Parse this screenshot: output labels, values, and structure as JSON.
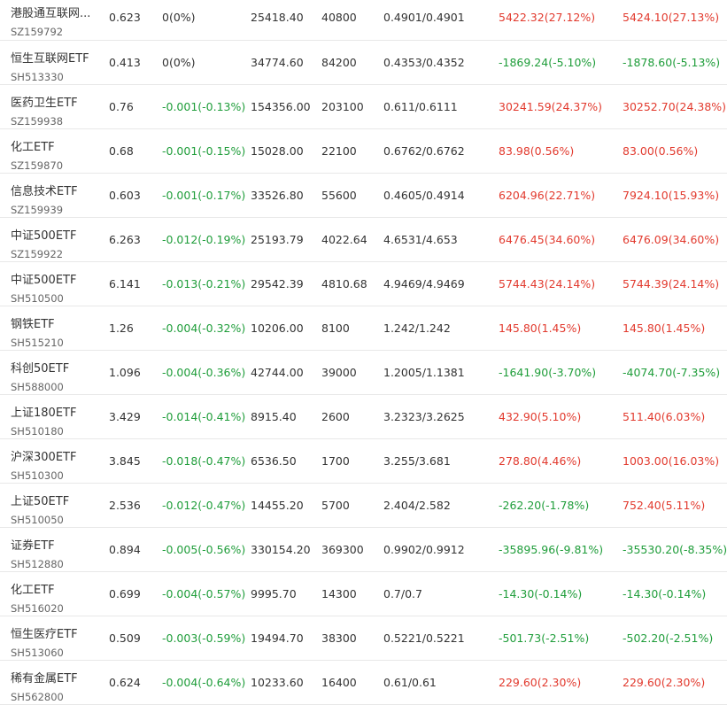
{
  "colors": {
    "up": "#e23a2e",
    "down": "#1f9d3a",
    "flat": "#333333"
  },
  "rows": [
    {
      "name": "港股通互联网...",
      "code": "SZ159792",
      "price": "0.623",
      "change": "0(0%)",
      "change_dir": "flat",
      "amount": "25418.40",
      "volume": "40800",
      "bid_ask": "0.4901/0.4901",
      "pnl1": "5422.32(27.12%)",
      "pnl1_dir": "up",
      "pnl2": "5424.10(27.13%)",
      "pnl2_dir": "up"
    },
    {
      "name": "恒生互联网ETF",
      "code": "SH513330",
      "price": "0.413",
      "change": "0(0%)",
      "change_dir": "flat",
      "amount": "34774.60",
      "volume": "84200",
      "bid_ask": "0.4353/0.4352",
      "pnl1": "-1869.24(-5.10%)",
      "pnl1_dir": "down",
      "pnl2": "-1878.60(-5.13%)",
      "pnl2_dir": "down"
    },
    {
      "name": "医药卫生ETF",
      "code": "SZ159938",
      "price": "0.76",
      "change": "-0.001(-0.13%)",
      "change_dir": "down",
      "amount": "154356.00",
      "volume": "203100",
      "bid_ask": "0.611/0.6111",
      "pnl1": "30241.59(24.37%)",
      "pnl1_dir": "up",
      "pnl2": "30252.70(24.38%)",
      "pnl2_dir": "up"
    },
    {
      "name": "化工ETF",
      "code": "SZ159870",
      "price": "0.68",
      "change": "-0.001(-0.15%)",
      "change_dir": "down",
      "amount": "15028.00",
      "volume": "22100",
      "bid_ask": "0.6762/0.6762",
      "pnl1": "83.98(0.56%)",
      "pnl1_dir": "up",
      "pnl2": "83.00(0.56%)",
      "pnl2_dir": "up"
    },
    {
      "name": "信息技术ETF",
      "code": "SZ159939",
      "price": "0.603",
      "change": "-0.001(-0.17%)",
      "change_dir": "down",
      "amount": "33526.80",
      "volume": "55600",
      "bid_ask": "0.4605/0.4914",
      "pnl1": "6204.96(22.71%)",
      "pnl1_dir": "up",
      "pnl2": "7924.10(15.93%)",
      "pnl2_dir": "up"
    },
    {
      "name": "中证500ETF",
      "code": "SZ159922",
      "price": "6.263",
      "change": "-0.012(-0.19%)",
      "change_dir": "down",
      "amount": "25193.79",
      "volume": "4022.64",
      "bid_ask": "4.6531/4.653",
      "pnl1": "6476.45(34.60%)",
      "pnl1_dir": "up",
      "pnl2": "6476.09(34.60%)",
      "pnl2_dir": "up"
    },
    {
      "name": "中证500ETF",
      "code": "SH510500",
      "price": "6.141",
      "change": "-0.013(-0.21%)",
      "change_dir": "down",
      "amount": "29542.39",
      "volume": "4810.68",
      "bid_ask": "4.9469/4.9469",
      "pnl1": "5744.43(24.14%)",
      "pnl1_dir": "up",
      "pnl2": "5744.39(24.14%)",
      "pnl2_dir": "up"
    },
    {
      "name": "钢铁ETF",
      "code": "SH515210",
      "price": "1.26",
      "change": "-0.004(-0.32%)",
      "change_dir": "down",
      "amount": "10206.00",
      "volume": "8100",
      "bid_ask": "1.242/1.242",
      "pnl1": "145.80(1.45%)",
      "pnl1_dir": "up",
      "pnl2": "145.80(1.45%)",
      "pnl2_dir": "up"
    },
    {
      "name": "科创50ETF",
      "code": "SH588000",
      "price": "1.096",
      "change": "-0.004(-0.36%)",
      "change_dir": "down",
      "amount": "42744.00",
      "volume": "39000",
      "bid_ask": "1.2005/1.1381",
      "pnl1": "-1641.90(-3.70%)",
      "pnl1_dir": "down",
      "pnl2": "-4074.70(-7.35%)",
      "pnl2_dir": "down"
    },
    {
      "name": "上证180ETF",
      "code": "SH510180",
      "price": "3.429",
      "change": "-0.014(-0.41%)",
      "change_dir": "down",
      "amount": "8915.40",
      "volume": "2600",
      "bid_ask": "3.2323/3.2625",
      "pnl1": "432.90(5.10%)",
      "pnl1_dir": "up",
      "pnl2": "511.40(6.03%)",
      "pnl2_dir": "up"
    },
    {
      "name": "沪深300ETF",
      "code": "SH510300",
      "price": "3.845",
      "change": "-0.018(-0.47%)",
      "change_dir": "down",
      "amount": "6536.50",
      "volume": "1700",
      "bid_ask": "3.255/3.681",
      "pnl1": "278.80(4.46%)",
      "pnl1_dir": "up",
      "pnl2": "1003.00(16.03%)",
      "pnl2_dir": "up"
    },
    {
      "name": "上证50ETF",
      "code": "SH510050",
      "price": "2.536",
      "change": "-0.012(-0.47%)",
      "change_dir": "down",
      "amount": "14455.20",
      "volume": "5700",
      "bid_ask": "2.404/2.582",
      "pnl1": "-262.20(-1.78%)",
      "pnl1_dir": "down",
      "pnl2": "752.40(5.11%)",
      "pnl2_dir": "up"
    },
    {
      "name": "证券ETF",
      "code": "SH512880",
      "price": "0.894",
      "change": "-0.005(-0.56%)",
      "change_dir": "down",
      "amount": "330154.20",
      "volume": "369300",
      "bid_ask": "0.9902/0.9912",
      "pnl1": "-35895.96(-9.81%)",
      "pnl1_dir": "down",
      "pnl2": "-35530.20(-8.35%)",
      "pnl2_dir": "down"
    },
    {
      "name": "化工ETF",
      "code": "SH516020",
      "price": "0.699",
      "change": "-0.004(-0.57%)",
      "change_dir": "down",
      "amount": "9995.70",
      "volume": "14300",
      "bid_ask": "0.7/0.7",
      "pnl1": "-14.30(-0.14%)",
      "pnl1_dir": "down",
      "pnl2": "-14.30(-0.14%)",
      "pnl2_dir": "down"
    },
    {
      "name": "恒生医疗ETF",
      "code": "SH513060",
      "price": "0.509",
      "change": "-0.003(-0.59%)",
      "change_dir": "down",
      "amount": "19494.70",
      "volume": "38300",
      "bid_ask": "0.5221/0.5221",
      "pnl1": "-501.73(-2.51%)",
      "pnl1_dir": "down",
      "pnl2": "-502.20(-2.51%)",
      "pnl2_dir": "down"
    },
    {
      "name": "稀有金属ETF",
      "code": "SH562800",
      "price": "0.624",
      "change": "-0.004(-0.64%)",
      "change_dir": "down",
      "amount": "10233.60",
      "volume": "16400",
      "bid_ask": "0.61/0.61",
      "pnl1": "229.60(2.30%)",
      "pnl1_dir": "up",
      "pnl2": "229.60(2.30%)",
      "pnl2_dir": "up"
    }
  ]
}
